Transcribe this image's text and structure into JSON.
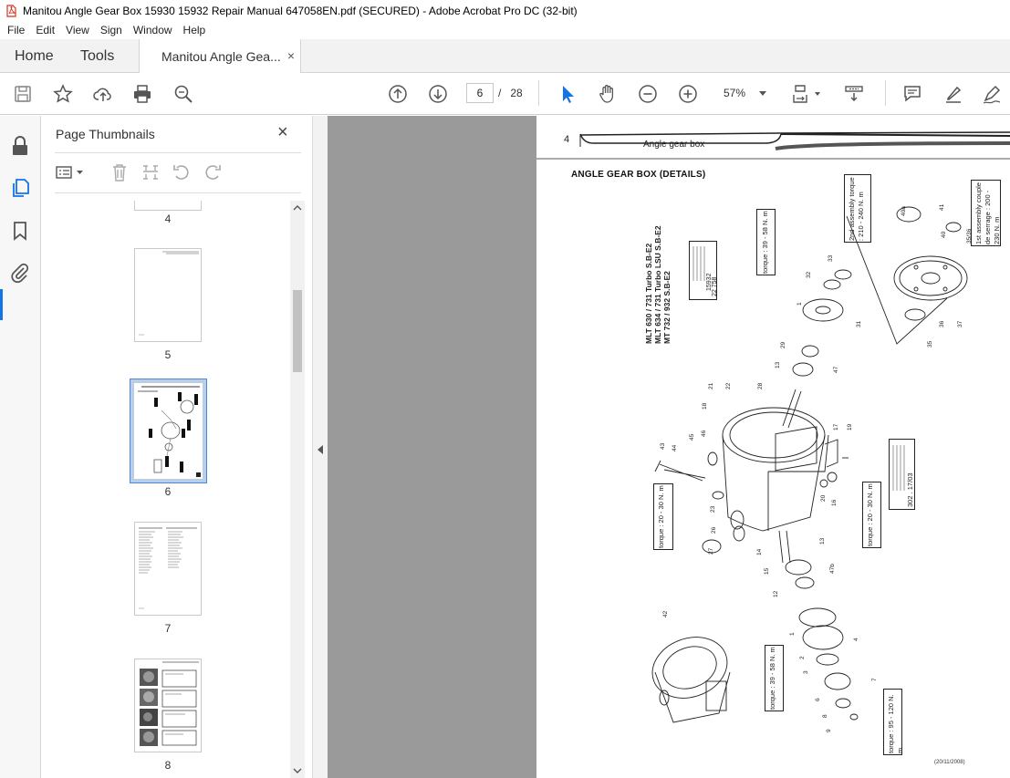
{
  "window": {
    "title": "Manitou Angle Gear Box 15930 15932 Repair Manual 647058EN.pdf (SECURED) - Adobe Acrobat Pro DC (32-bit)"
  },
  "menu": {
    "file": "File",
    "edit": "Edit",
    "view": "View",
    "sign": "Sign",
    "window": "Window",
    "help": "Help"
  },
  "tabs": {
    "home": "Home",
    "tools": "Tools",
    "document": "Manitou Angle Gea...",
    "close_glyph": "×"
  },
  "toolbar": {
    "current_page": "6",
    "page_separator": "/",
    "total_pages": "28",
    "zoom": "57%"
  },
  "panel": {
    "title": "Page Thumbnails",
    "close_glyph": "×"
  },
  "thumbnails": [
    {
      "label": "4"
    },
    {
      "label": "5"
    },
    {
      "label": "6",
      "selected": true
    },
    {
      "label": "7"
    },
    {
      "label": "8"
    }
  ],
  "document": {
    "page_number": "4",
    "header_text": "Angle gear  box",
    "section_title": "ANGLE GEAR  BOX (DETAILS)",
    "models": [
      "MLT 630 / 731 Turbo S.B-E2",
      "MLT 634 / 731 Turbo LSU S.B-E2",
      "MT 732 / 932 S.B-E2"
    ],
    "type_codes": [
      "15932",
      "22 758"
    ],
    "torque_callouts": [
      "torque : 39 - 58 N. m",
      "2nd assembly torque : 210 - 240 N. m",
      "1st assembly couple de serrage : 200 - 230 N. m",
      "torque : 20 - 30 N. m",
      "torque : 20 - 30 N. m",
      "torque : 39 - 58 N. m",
      "torque : 95 - 120 N. m"
    ],
    "ref_code": "302 . 17/03",
    "date": "(20/11/2008)"
  }
}
